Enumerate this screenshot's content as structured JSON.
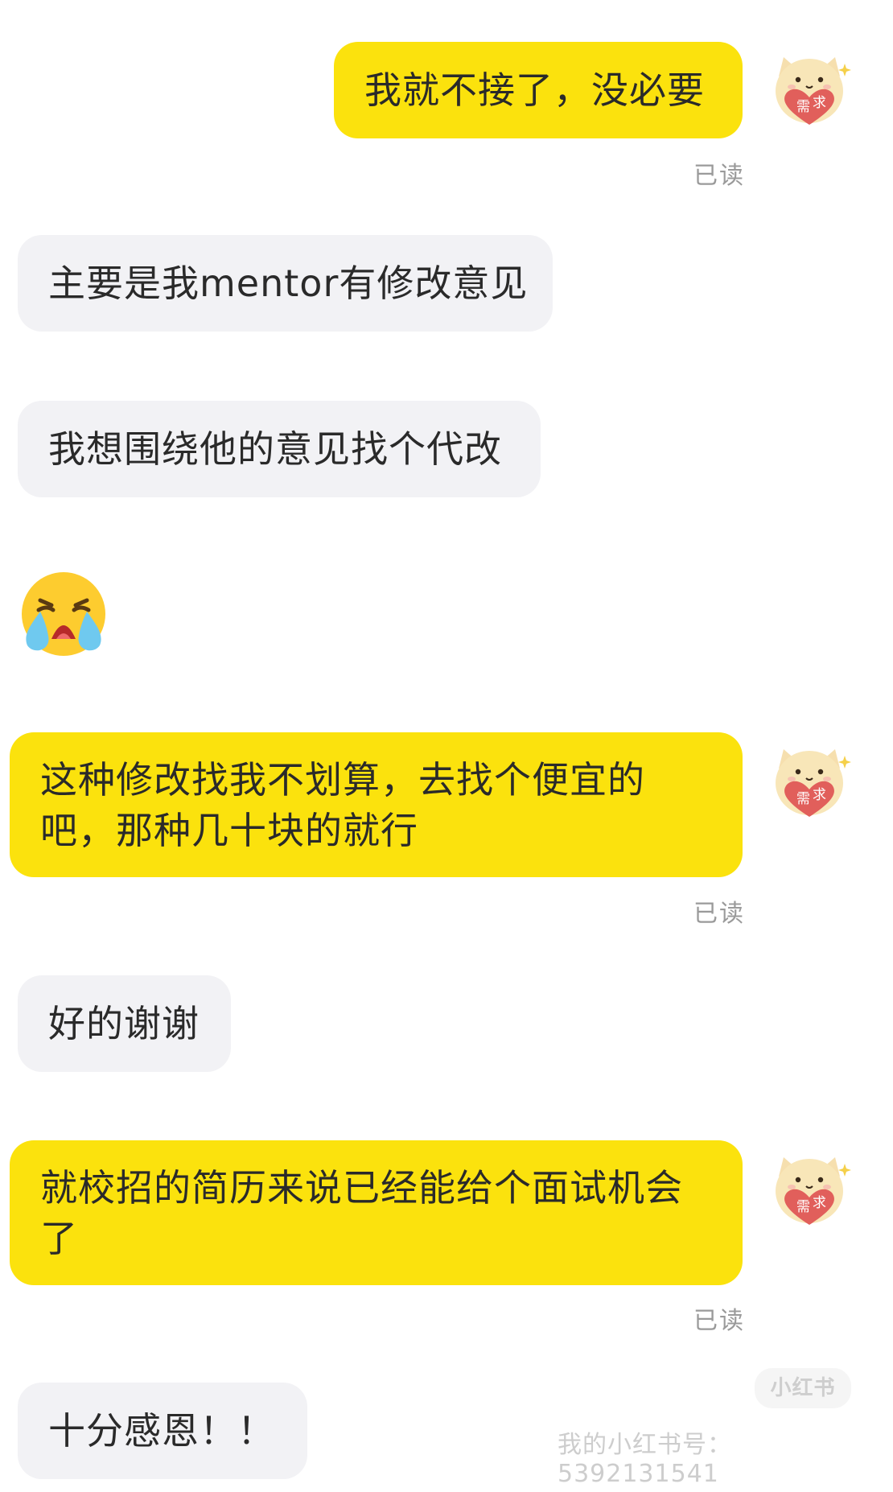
{
  "messages": [
    {
      "id": "m1",
      "direction": "outgoing",
      "text": "我就不接了，没必要",
      "status": "已读"
    },
    {
      "id": "m2",
      "direction": "incoming",
      "text": "主要是我mentor有修改意见"
    },
    {
      "id": "m3",
      "direction": "incoming",
      "text": "我想围绕他的意见找个代改"
    },
    {
      "id": "m4",
      "direction": "incoming",
      "emoji": "crying-face"
    },
    {
      "id": "m5",
      "direction": "outgoing",
      "text": "这种修改找我不划算，去找个便宜的吧，那种几十块的就行",
      "status": "已读"
    },
    {
      "id": "m6",
      "direction": "incoming",
      "text": "好的谢谢"
    },
    {
      "id": "m7",
      "direction": "outgoing",
      "text": "就校招的简历来说已经能给个面试机会了",
      "status": "已读"
    },
    {
      "id": "m8",
      "direction": "incoming",
      "text": "十分感恩！！"
    }
  ],
  "avatar": {
    "name": "cat-holding-heart-avatar",
    "heart_text": "需求"
  },
  "watermark": {
    "logo": "小红书",
    "text": "我的小红书号：5392131541"
  },
  "colors": {
    "outgoing_bubble": "#fbe20d",
    "incoming_bubble": "#f2f2f5",
    "read_receipt": "#9a9a9a",
    "background": "#ffffff"
  }
}
